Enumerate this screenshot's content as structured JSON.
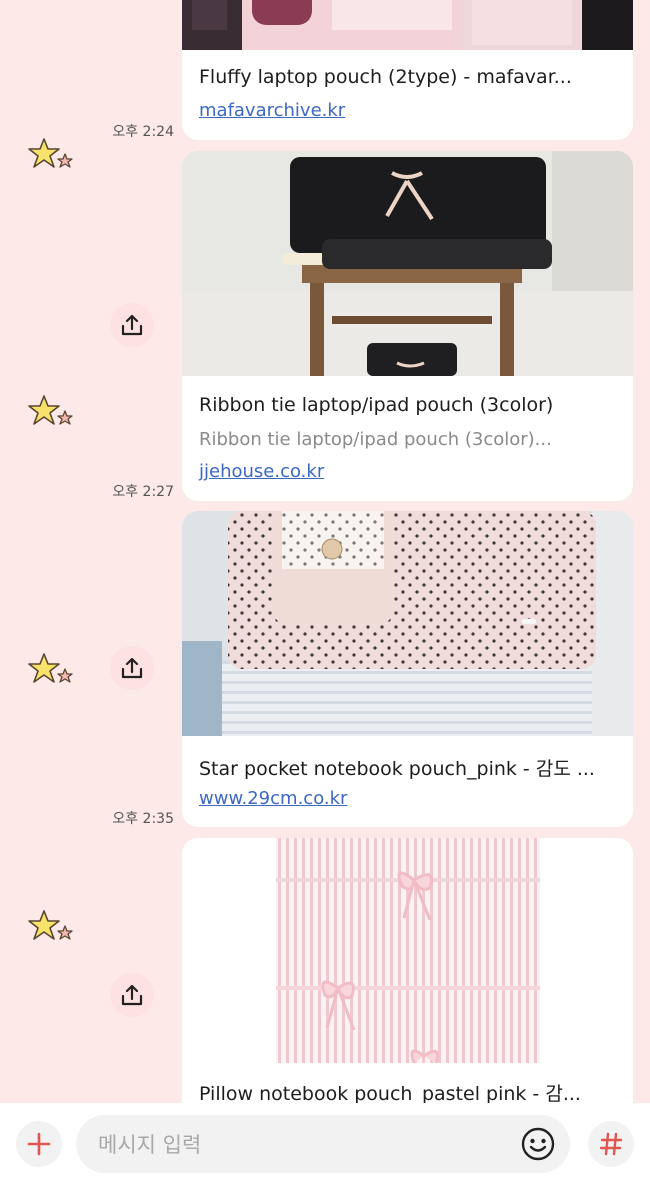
{
  "messages": [
    {
      "title": "Fluffy laptop pouch (2type) - mafavar...",
      "link": "mafavarchive.kr",
      "time": "오후 2:24"
    },
    {
      "title": "Ribbon tie laptop/ipad pouch (3color)",
      "description": "Ribbon tie laptop/ipad pouch (3color)...",
      "link": "jjehouse.co.kr",
      "time": "오후 2:27"
    },
    {
      "title": "Star pocket notebook pouch_pink - 감도 ...",
      "link": "www.29cm.co.kr",
      "time": "오후 2:35"
    },
    {
      "title": "Pillow notebook pouch_pastel pink - 감..."
    }
  ],
  "composer": {
    "placeholder": "메시지 입력"
  },
  "colors": {
    "background": "#fde9e8",
    "link": "#3c68c4",
    "accent": "#e0554f"
  },
  "icons": [
    "star-avatar-icon",
    "share-icon",
    "plus-icon",
    "emoji-icon",
    "hashtag-icon"
  ]
}
